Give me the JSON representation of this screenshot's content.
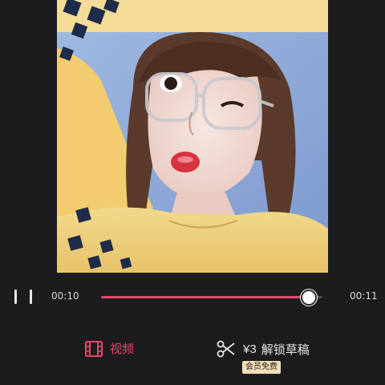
{
  "player": {
    "current_time": "00:10",
    "duration": "00:11",
    "progress": 0.93
  },
  "actions": {
    "video_label": "视频",
    "unlock_price": "¥3",
    "unlock_label": "解锁草稿",
    "vip_badge": "会员免费"
  },
  "colors": {
    "accent": "#e8476a",
    "background": "#1c1c1e",
    "badge_bg": "#f3dfb8"
  },
  "icons": {
    "pause": "pause-icon",
    "video": "film-icon",
    "scissors": "scissors-icon"
  }
}
